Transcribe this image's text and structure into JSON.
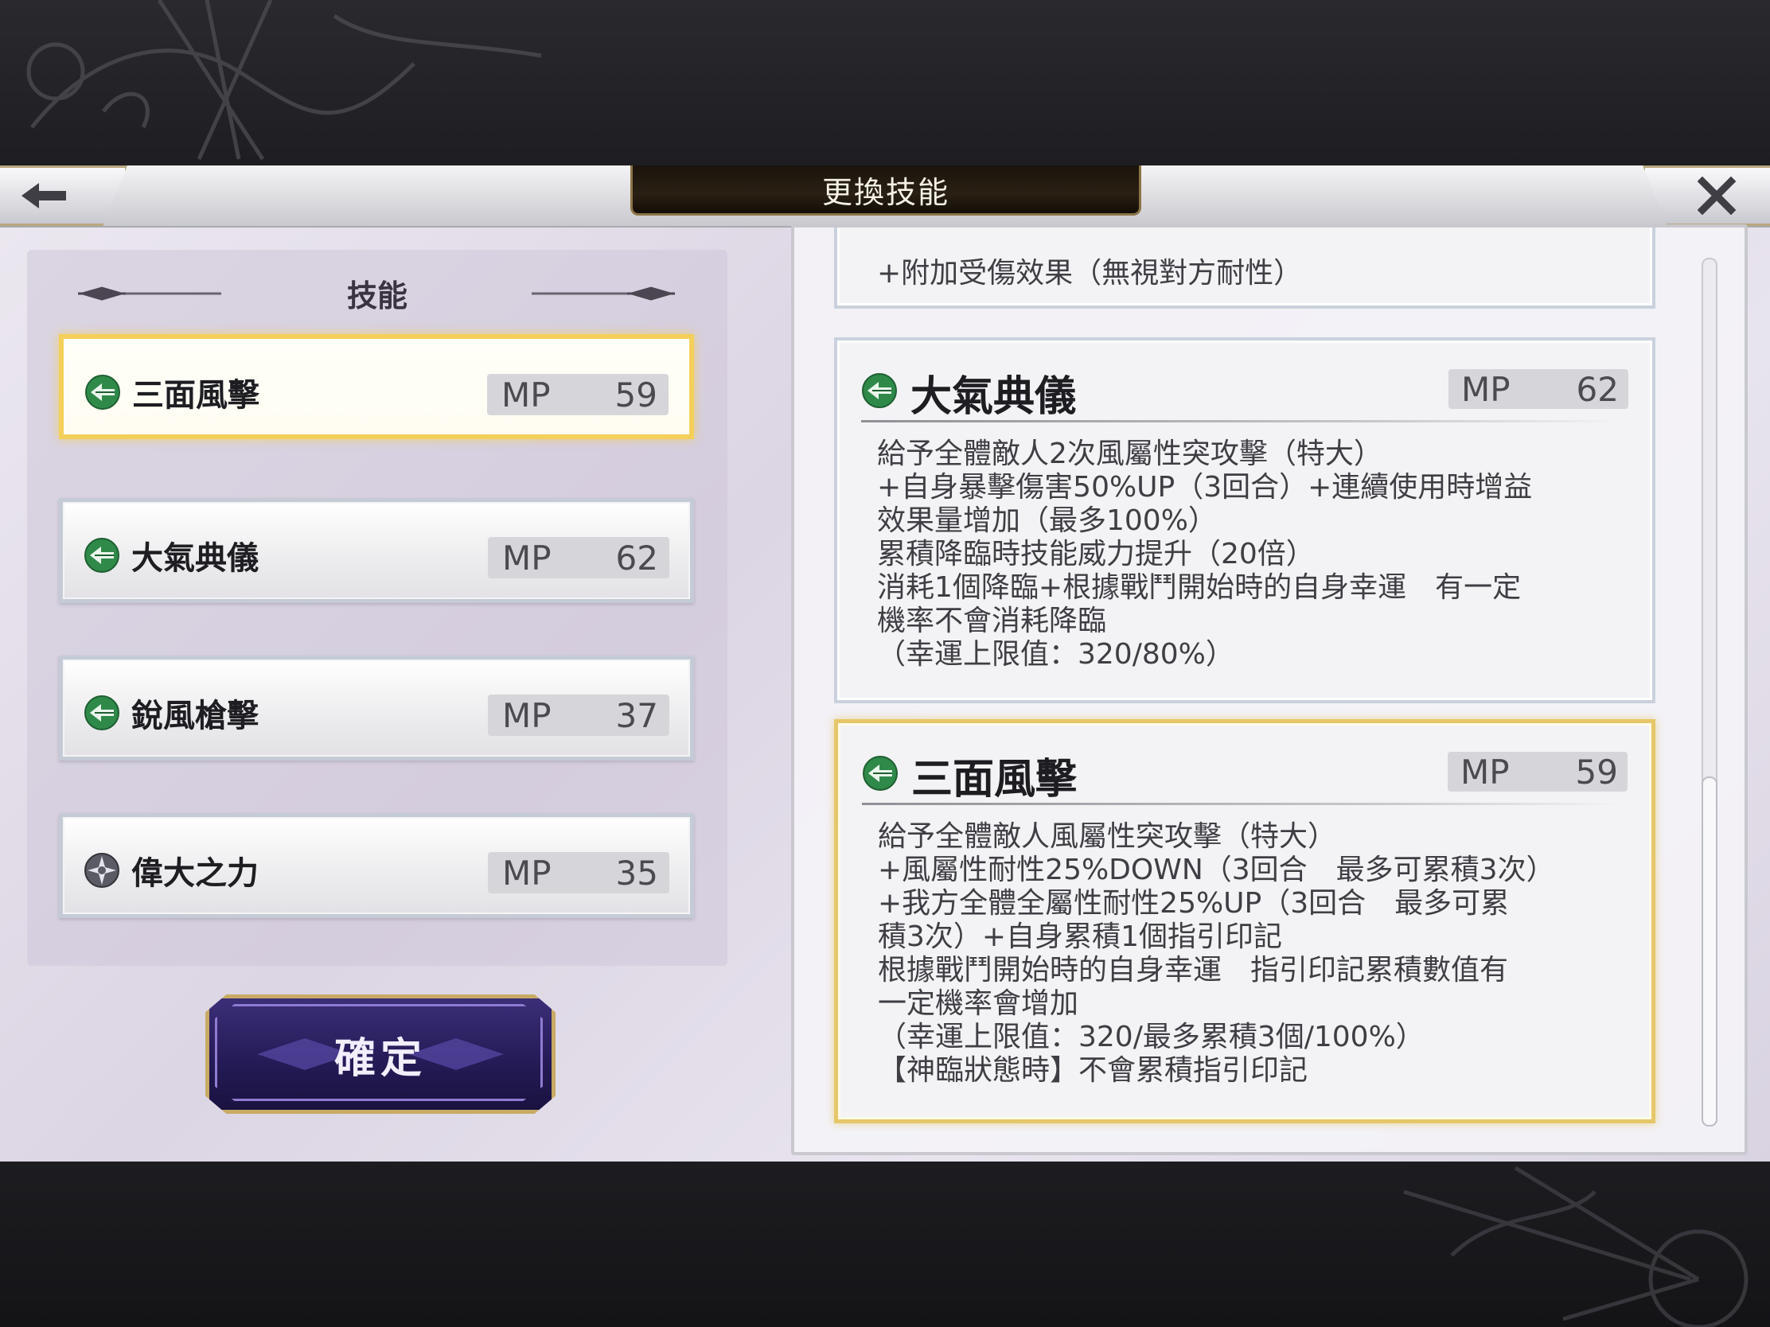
{
  "header": {
    "title": "更換技能",
    "back_icon": "arrow-left-icon",
    "close_icon": "close-icon"
  },
  "left_panel": {
    "title": "技能",
    "skills": [
      {
        "name": "三面風擊",
        "mp_label": "MP",
        "mp": "59",
        "icon": "wind-element-icon",
        "selected": true
      },
      {
        "name": "大氣典儀",
        "mp_label": "MP",
        "mp": "62",
        "icon": "wind-element-icon",
        "selected": false
      },
      {
        "name": "銳風槍擊",
        "mp_label": "MP",
        "mp": "37",
        "icon": "wind-element-icon",
        "selected": false
      },
      {
        "name": "偉大之力",
        "mp_label": "MP",
        "mp": "35",
        "icon": "compass-star-icon",
        "selected": false
      }
    ],
    "confirm_label": "確定"
  },
  "right_panel": {
    "partial_line": "+附加受傷效果（無視對方耐性）",
    "cards": [
      {
        "name": "大氣典儀",
        "mp_label": "MP",
        "mp": "62",
        "icon": "wind-element-icon",
        "selected": false,
        "lines": [
          "給予全體敵人2次風屬性突攻擊（特大）",
          "+自身暴擊傷害50%UP（3回合）+連續使用時增益",
          "效果量增加（最多100%）",
          "累積降臨時技能威力提升（20倍）",
          "消耗1個降臨+根據戰鬥開始時的自身幸運　有一定",
          "機率不會消耗降臨",
          "（幸運上限值：320/80%）"
        ]
      },
      {
        "name": "三面風擊",
        "mp_label": "MP",
        "mp": "59",
        "icon": "wind-element-icon",
        "selected": true,
        "lines": [
          "給予全體敵人風屬性突攻擊（特大）",
          "+風屬性耐性25%DOWN（3回合　最多可累積3次）",
          "+我方全體全屬性耐性25%UP（3回合　最多可累",
          "積3次）+自身累積1個指引印記",
          "根據戰鬥開始時的自身幸運　指引印記累積數值有",
          "一定機率會增加",
          "（幸運上限值：320/最多累積3個/100%）",
          "【神臨狀態時】不會累積指引印記"
        ]
      }
    ]
  },
  "colors": {
    "selected_border": "#f4cf5a",
    "wind_icon": "#2f8a4a",
    "confirm_button": "#2a1f60"
  }
}
